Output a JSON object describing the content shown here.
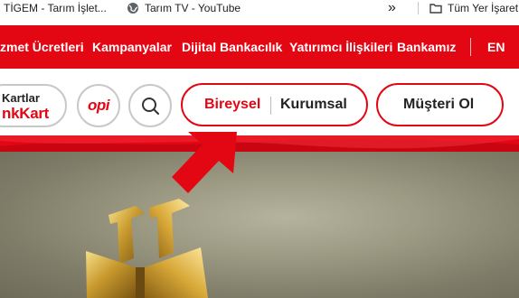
{
  "bookmarks": [
    {
      "label": "TİGEM - Tarım İşlet...",
      "icon": "tigem-favicon"
    },
    {
      "label": "Tarım TV - YouTube",
      "icon": "globe-icon"
    },
    {
      "label": "Tüm Yer İşaret",
      "icon": "folder-icon"
    }
  ],
  "bookmarks_overflow": "»",
  "topnav": {
    "items": [
      "zmet Ücretleri",
      "Kampanyalar",
      "Dijital Bankacılık",
      "Yatırımcı İlişkileri",
      "Bankamız"
    ],
    "lang": "EN"
  },
  "header": {
    "cards_line1": "Kartlar",
    "cards_line2": "nkKart",
    "opi_label": "opi",
    "segment_individual": "Bireysel",
    "segment_corporate": "Kurumsal",
    "customer_button": "Müşteri Ol"
  },
  "colors": {
    "brand_red": "#e30613",
    "border_gray": "#c8c8c8",
    "text_dark": "#222222"
  }
}
